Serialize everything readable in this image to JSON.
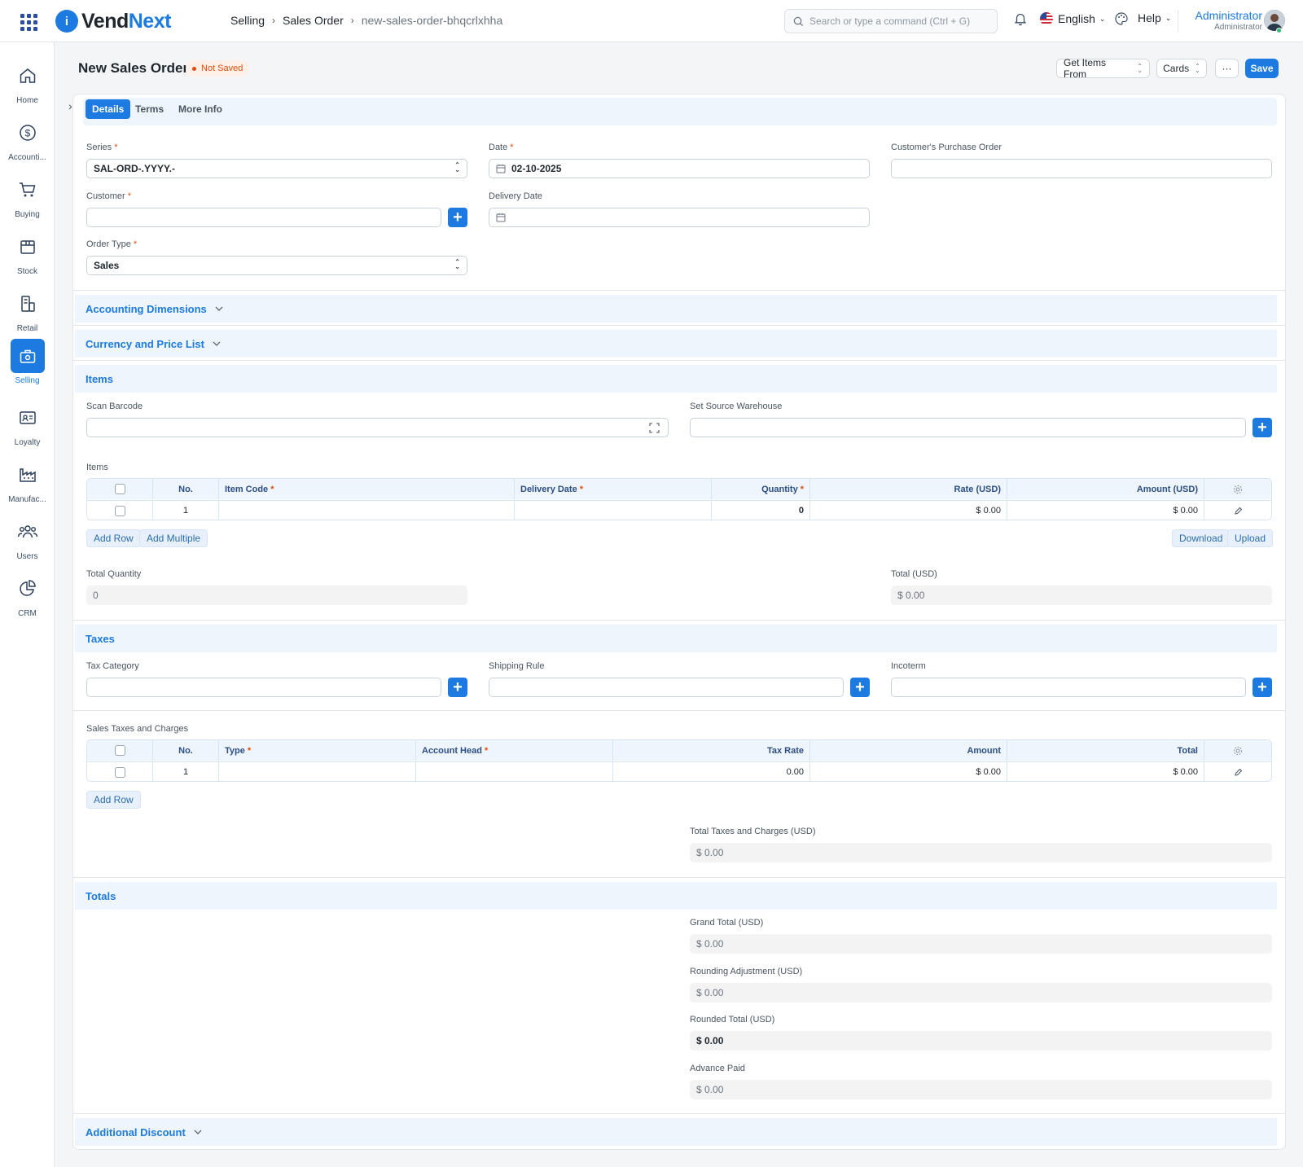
{
  "app": {
    "logo_prefix": "i",
    "logo_mid": "Vend",
    "logo_accent": "Next"
  },
  "breadcrumb": [
    "Selling",
    "Sales Order",
    "new-sales-order-bhqcrlxhha"
  ],
  "search": {
    "placeholder": "Search or type a command (Ctrl + G)"
  },
  "nav": {
    "language": "English",
    "help": "Help",
    "user_name": "Administrator",
    "user_role": "Administrator"
  },
  "sidebar": {
    "items": [
      {
        "label": "Home",
        "icon": "home-icon"
      },
      {
        "label": "Accounti...",
        "icon": "dollar-icon"
      },
      {
        "label": "Buying",
        "icon": "cart-icon"
      },
      {
        "label": "Stock",
        "icon": "box-icon"
      },
      {
        "label": "Retail",
        "icon": "pos-icon"
      },
      {
        "label": "Selling",
        "icon": "selling-icon",
        "active": true
      },
      {
        "label": "Loyalty",
        "icon": "card-icon"
      },
      {
        "label": "Manufac...",
        "icon": "factory-icon"
      },
      {
        "label": "Users",
        "icon": "users-icon"
      },
      {
        "label": "CRM",
        "icon": "chart-icon"
      }
    ]
  },
  "page": {
    "title": "New Sales Order",
    "status": "Not Saved",
    "get_items_label": "Get Items From",
    "cards_label": "Cards",
    "more_label": "···",
    "save_label": "Save"
  },
  "tabs": [
    "Details",
    "Terms",
    "More Info"
  ],
  "fields": {
    "series": {
      "label": "Series",
      "value": "SAL-ORD-.YYYY.-"
    },
    "date": {
      "label": "Date",
      "value": "02-10-2025"
    },
    "customer_po": {
      "label": "Customer's Purchase Order",
      "value": ""
    },
    "customer": {
      "label": "Customer",
      "value": ""
    },
    "delivery_date": {
      "label": "Delivery Date",
      "value": ""
    },
    "order_type": {
      "label": "Order Type",
      "value": "Sales"
    }
  },
  "sections": {
    "accounting_dimensions": "Accounting Dimensions",
    "currency_price_list": "Currency and Price List",
    "items": "Items",
    "taxes": "Taxes",
    "totals": "Totals",
    "additional_discount": "Additional Discount"
  },
  "items_section": {
    "scan_barcode_label": "Scan Barcode",
    "source_warehouse_label": "Set Source Warehouse",
    "table_label": "Items",
    "columns": {
      "no": "No.",
      "item_code": "Item Code",
      "delivery_date": "Delivery Date",
      "quantity": "Quantity",
      "rate": "Rate (USD)",
      "amount": "Amount (USD)"
    },
    "row": {
      "no": "1",
      "item_code": "",
      "delivery_date": "",
      "quantity": "0",
      "rate": "$ 0.00",
      "amount": "$ 0.00"
    },
    "add_row": "Add Row",
    "add_multiple": "Add Multiple",
    "download": "Download",
    "upload": "Upload",
    "total_qty_label": "Total Quantity",
    "total_qty_value": "0",
    "total_label": "Total (USD)",
    "total_value": "$ 0.00"
  },
  "taxes_section": {
    "tax_category_label": "Tax Category",
    "shipping_rule_label": "Shipping Rule",
    "incoterm_label": "Incoterm",
    "table_label": "Sales Taxes and Charges",
    "columns": {
      "no": "No.",
      "type": "Type",
      "account_head": "Account Head",
      "tax_rate": "Tax Rate",
      "amount": "Amount",
      "total": "Total"
    },
    "row": {
      "no": "1",
      "type": "",
      "account_head": "",
      "tax_rate": "0.00",
      "amount": "$ 0.00",
      "total": "$ 0.00"
    },
    "add_row": "Add Row",
    "total_taxes_label": "Total Taxes and Charges (USD)",
    "total_taxes_value": "$ 0.00"
  },
  "totals_section": {
    "grand_total_label": "Grand Total (USD)",
    "grand_total_value": "$ 0.00",
    "rounding_adj_label": "Rounding Adjustment (USD)",
    "rounding_adj_value": "$ 0.00",
    "rounded_total_label": "Rounded Total (USD)",
    "rounded_total_value": "$ 0.00",
    "advance_paid_label": "Advance Paid",
    "advance_paid_value": "$ 0.00"
  },
  "colors": {
    "accent": "#1c7ae0",
    "status_warning": "#e24c0a",
    "section_bg": "#eef5fc"
  }
}
